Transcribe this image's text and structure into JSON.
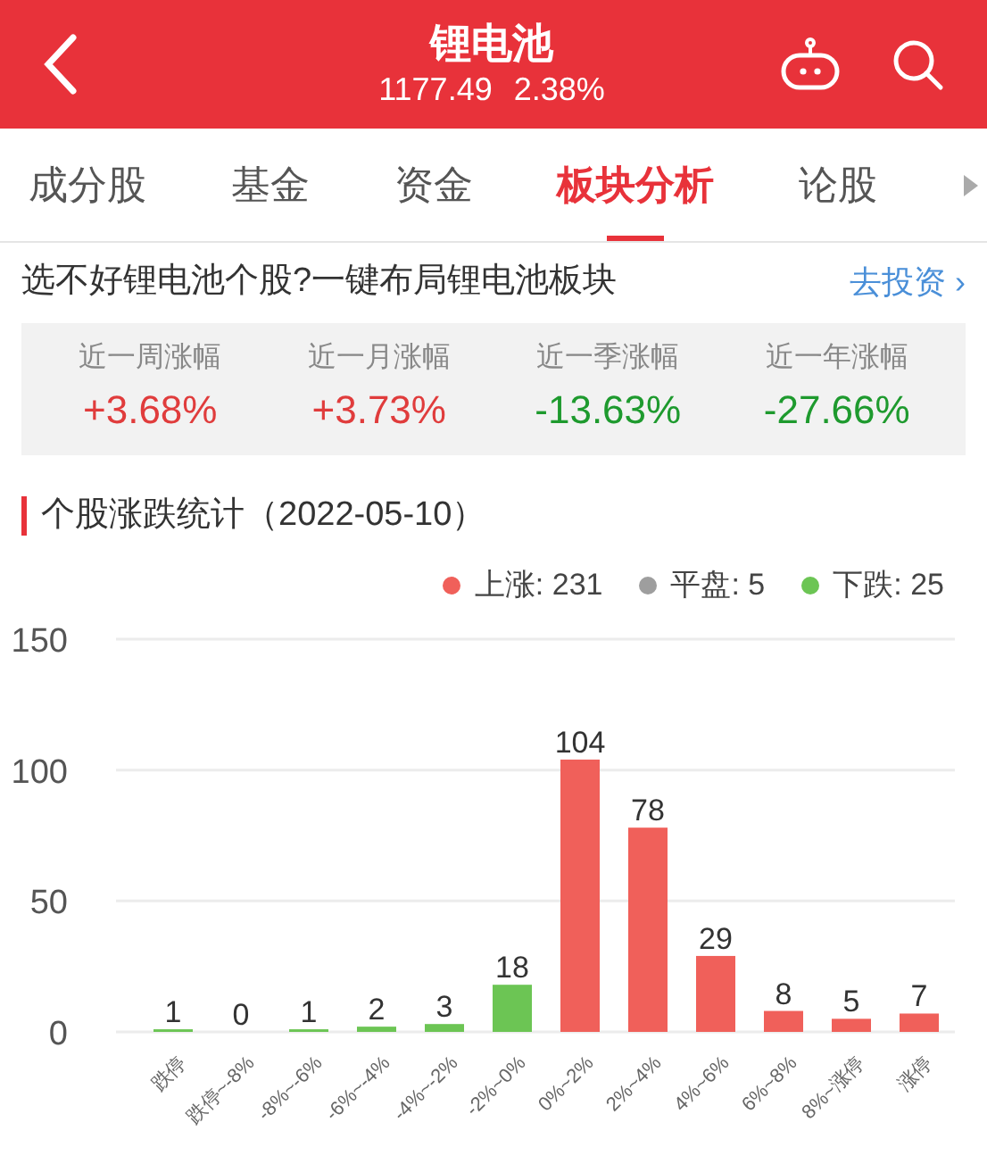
{
  "header": {
    "title": "锂电池",
    "price": "1177.49",
    "change": "2.38%"
  },
  "tabs": [
    {
      "label": "成分股",
      "selected": false
    },
    {
      "label": "基金",
      "selected": false
    },
    {
      "label": "资金",
      "selected": false
    },
    {
      "label": "板块分析",
      "selected": true
    },
    {
      "label": "论股",
      "selected": false
    }
  ],
  "banner": {
    "text": "选不好锂电池个股?一键布局锂电池板块",
    "link": "去投资",
    "link_arrow": "›"
  },
  "stats": [
    {
      "label": "近一周涨幅",
      "value": "+3.68%",
      "color": "#e03c3c"
    },
    {
      "label": "近一月涨幅",
      "value": "+3.73%",
      "color": "#e03c3c"
    },
    {
      "label": "近一季涨幅",
      "value": "-13.63%",
      "color": "#1e9a2e"
    },
    {
      "label": "近一年涨幅",
      "value": "-27.66%",
      "color": "#1e9a2e"
    }
  ],
  "section": {
    "title": "个股涨跌统计（2022-05-10）"
  },
  "legend": [
    {
      "kind": "series",
      "count": ": 231"
    },
    {
      "kind": "plain",
      "name": "平盘",
      "count": ": 5",
      "color": "#9e9e9e"
    },
    {
      "kind": "series",
      "count": ": 25"
    }
  ],
  "chart_data": {
    "type": "bar",
    "categories": [
      "跌停",
      "跌停~-8%",
      "-8%~-6%",
      "-6%~-4%",
      "-4%~-2%",
      "-2%~0%",
      "0%~2%",
      "2%~4%",
      "4%~6%",
      "6%~8%",
      "8%~涨停",
      "涨停"
    ],
    "series": [
      {
        "name": "上涨",
        "color": "#f0605a",
        "values": [
          null,
          null,
          null,
          null,
          null,
          null,
          104,
          78,
          29,
          8,
          5,
          7
        ]
      },
      {
        "name": "下跌",
        "color": "#6cc554",
        "values": [
          1,
          0,
          1,
          2,
          3,
          18,
          null,
          null,
          null,
          null,
          null,
          null
        ]
      }
    ],
    "ylim": [
      0,
      150
    ],
    "yticks": [
      0,
      50,
      100,
      150
    ],
    "data_labels": true
  }
}
